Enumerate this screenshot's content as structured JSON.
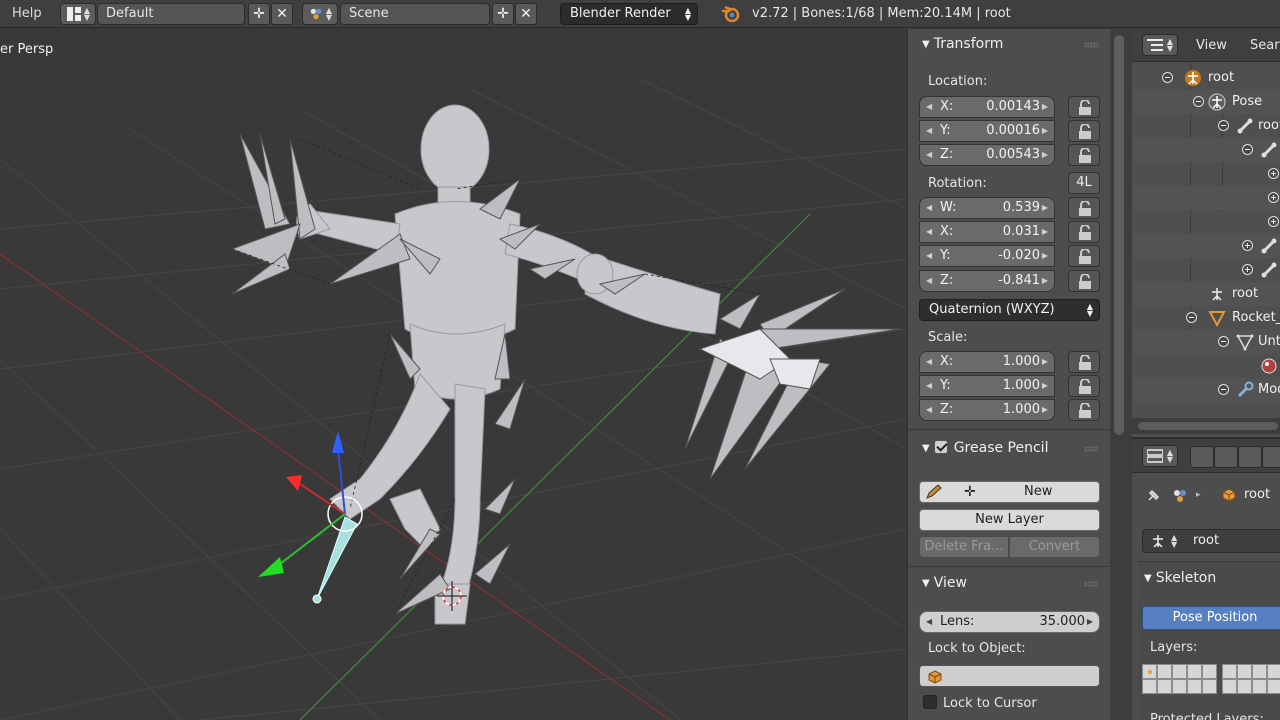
{
  "topbar": {
    "help_menu": "Help",
    "screen_layout": "Default",
    "scene": "Scene",
    "render_engine": "Blender Render",
    "stats": "v2.72 | Bones:1/68 | Mem:20.14M | root"
  },
  "viewport": {
    "view_label": "er Persp"
  },
  "npanel": {
    "transform": {
      "header": "Transform",
      "location_label": "Location:",
      "location": [
        {
          "axis": "X:",
          "value": "0.00143"
        },
        {
          "axis": "Y:",
          "value": "0.00016"
        },
        {
          "axis": "Z:",
          "value": "0.00543"
        }
      ],
      "rotation_label": "Rotation:",
      "lock4_label": "4L",
      "rotation": [
        {
          "axis": "W:",
          "value": "0.539"
        },
        {
          "axis": "X:",
          "value": "0.031"
        },
        {
          "axis": "Y:",
          "value": "-0.020"
        },
        {
          "axis": "Z:",
          "value": "-0.841"
        }
      ],
      "rotation_mode": "Quaternion (WXYZ)",
      "scale_label": "Scale:",
      "scale": [
        {
          "axis": "X:",
          "value": "1.000"
        },
        {
          "axis": "Y:",
          "value": "1.000"
        },
        {
          "axis": "Z:",
          "value": "1.000"
        }
      ]
    },
    "grease_pencil": {
      "header": "Grease Pencil",
      "new": "New",
      "new_layer": "New Layer",
      "delete_frame": "Delete Fra...",
      "convert": "Convert"
    },
    "view": {
      "header": "View",
      "lens_label": "Lens:",
      "lens_value": "35.000",
      "lock_to_object": "Lock to Object:",
      "lock_to_cursor": "Lock to Cursor"
    }
  },
  "outliner": {
    "menu_view": "View",
    "menu_search": "Searc",
    "rows": [
      {
        "label": "root"
      },
      {
        "label": "Pose"
      },
      {
        "label": "root"
      },
      {
        "label": ""
      },
      {
        "label": ""
      },
      {
        "label": ""
      },
      {
        "label": ""
      },
      {
        "label": ""
      },
      {
        "label": ""
      },
      {
        "label": "root"
      },
      {
        "label": "Rocket_"
      },
      {
        "label": "Unt"
      },
      {
        "label": ""
      },
      {
        "label": "Mod"
      }
    ]
  },
  "properties": {
    "breadcrumb_object": "root",
    "armature_name": "root",
    "skeleton_header": "Skeleton",
    "pose_position": "Pose Position",
    "layers_label": "Layers:",
    "protected_layers_label": "Protected Layers:"
  },
  "colors": {
    "accent_blue": "#5680c2",
    "axis_red": "#b03a3a",
    "axis_green": "#3aa03a"
  }
}
